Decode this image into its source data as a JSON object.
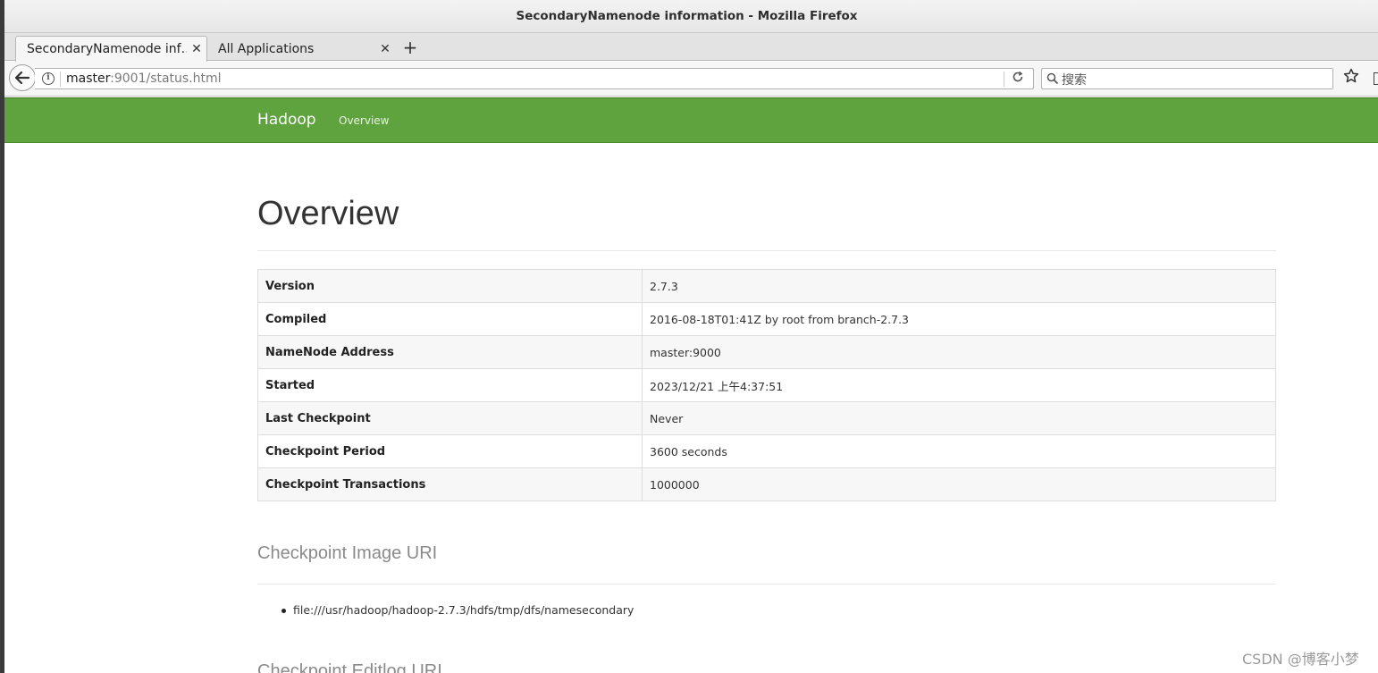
{
  "window": {
    "title": "SecondaryNamenode information - Mozilla Firefox"
  },
  "tabs": [
    {
      "label": "SecondaryNamenode inf…",
      "close": "✕"
    },
    {
      "label": "All Applications",
      "close": "✕"
    }
  ],
  "new_tab_label": "+",
  "navbar": {
    "url_host": "master",
    "url_rest": ":9001/status.html",
    "search_placeholder": "搜索",
    "icons": [
      "back-arrow-icon",
      "info-icon",
      "reload-icon",
      "search-icon",
      "bookmark-star-icon",
      "library-icon"
    ]
  },
  "header": {
    "brand": "Hadoop",
    "nav_items": [
      "Overview"
    ],
    "color": "#5fa33e"
  },
  "page": {
    "title": "Overview",
    "rows": [
      {
        "key": "Version",
        "value": "2.7.3"
      },
      {
        "key": "Compiled",
        "value": "2016-08-18T01:41Z by root from branch-2.7.3"
      },
      {
        "key": "NameNode Address",
        "value": "master:9000"
      },
      {
        "key": "Started",
        "value": "2023/12/21 上午4:37:51"
      },
      {
        "key": "Last Checkpoint",
        "value": "Never"
      },
      {
        "key": "Checkpoint Period",
        "value": "3600 seconds"
      },
      {
        "key": "Checkpoint Transactions",
        "value": "1000000"
      }
    ],
    "sections": [
      {
        "heading": "Checkpoint Image URI",
        "items": [
          "file:///usr/hadoop/hadoop-2.7.3/hdfs/tmp/dfs/namesecondary"
        ]
      },
      {
        "heading": "Checkpoint Editlog URI"
      }
    ]
  },
  "watermark": "CSDN @博客小梦"
}
